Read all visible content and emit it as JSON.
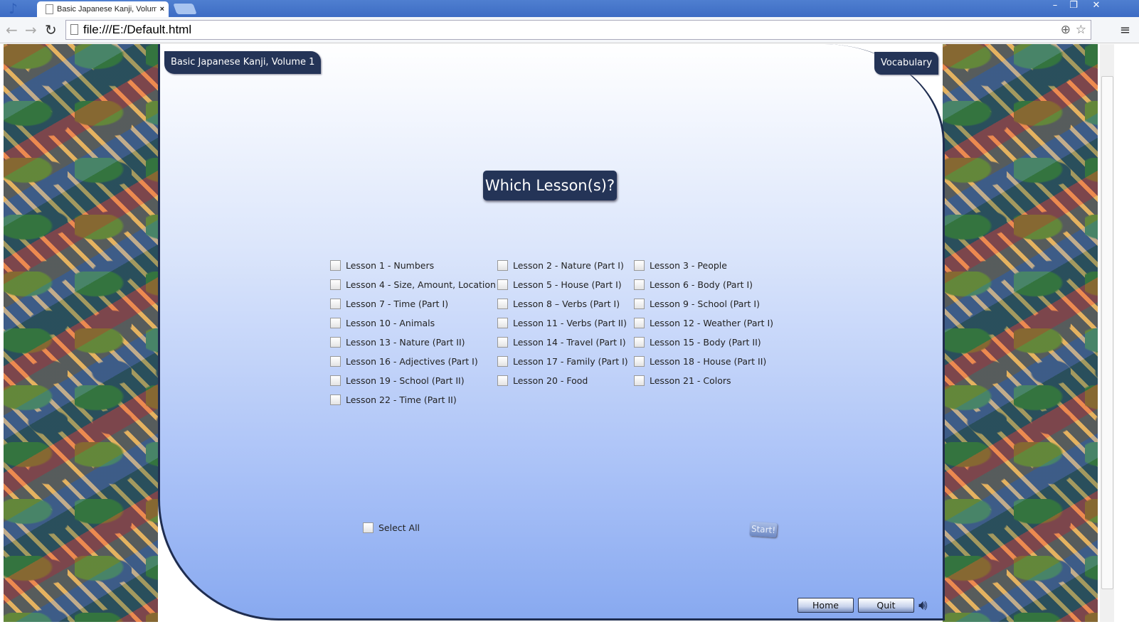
{
  "browser": {
    "tab_title": "Basic Japanese Kanji, Volume 1",
    "url": "file:///E:/Default.html"
  },
  "app": {
    "title_badge": "Basic Japanese Kanji, Volume 1",
    "vocabulary": "Vocabulary",
    "heading": "Which Lesson(s)?",
    "lessons": [
      "Lesson 1 - Numbers",
      "Lesson 2 - Nature (Part I)",
      "Lesson 3 - People",
      "Lesson 4 - Size, Amount, Location",
      "Lesson 5 - House (Part I)",
      "Lesson 6 - Body (Part I)",
      "Lesson 7 - Time (Part I)",
      "Lesson 8 – Verbs (Part I)",
      "Lesson 9 - School (Part I)",
      "Lesson 10 - Animals",
      "Lesson 11 - Verbs (Part II)",
      "Lesson 12 - Weather (Part I)",
      "Lesson 13 - Nature (Part II)",
      "Lesson 14 - Travel (Part I)",
      "Lesson 15 - Body (Part II)",
      "Lesson 16 - Adjectives (Part I)",
      "Lesson 17 - Family (Part I)",
      "Lesson 18 - House (Part II)",
      "Lesson 19 - School (Part II)",
      "Lesson 20 - Food",
      "Lesson 21 - Colors",
      "Lesson 22 - Time (Part II)"
    ],
    "select_all": "Select All",
    "start": "Start!",
    "home": "Home",
    "quit": "Quit"
  }
}
